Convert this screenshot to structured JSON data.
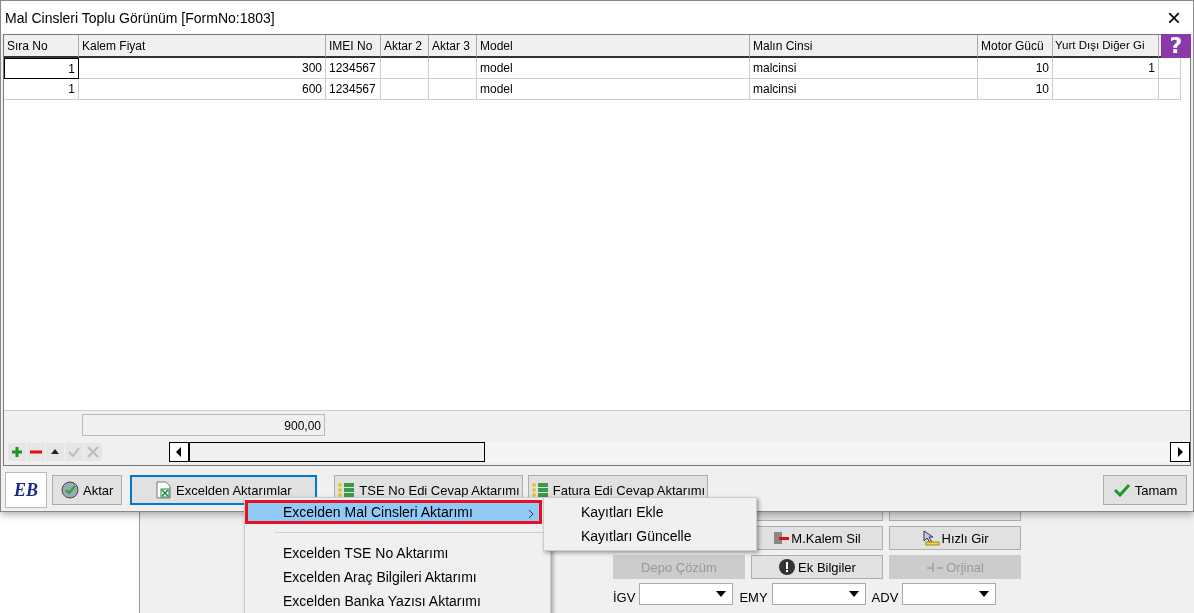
{
  "window": {
    "title": "Mal Cinsleri Toplu Görünüm [FormNo:1803]",
    "close": "×",
    "help": "?"
  },
  "table": {
    "columns": [
      "Sıra No",
      "Kalem Fiyat",
      "IMEI No",
      "Aktar 2",
      "Aktar 3",
      "Model",
      "Malın Cinsi",
      "Motor Gücü",
      "Yurt Dışı Diğer Gi"
    ],
    "rows": [
      {
        "selected": true,
        "cells": [
          "1",
          "300",
          "1234567",
          null,
          null,
          "model",
          "malcinsi",
          "10",
          "1"
        ]
      },
      {
        "selected": false,
        "cells": [
          "1",
          "600",
          "1234567",
          null,
          null,
          "model",
          "malcinsi",
          "10",
          null
        ]
      }
    ],
    "total": "900,00"
  },
  "buttons": [
    {
      "kind": "logo",
      "label": "EB"
    },
    {
      "kind": "aktar",
      "label": "Aktar"
    },
    {
      "kind": "excel",
      "label": "Excelden Aktarımlar",
      "focused": true
    },
    {
      "kind": "list",
      "label": "TSE No Edi Cevap Aktarımı"
    },
    {
      "kind": "list",
      "label": "Fatura Edi Cevap Aktarımı"
    }
  ],
  "ok_button": "Tamam",
  "menu": [
    {
      "label": "Excelden Mal Cinsleri Aktarımı",
      "selected": true,
      "submenu": true
    },
    {
      "label": "Excelden TSE No Aktarımı",
      "selected": false,
      "submenu": false
    },
    {
      "label": "Excelden Araç Bilgileri Aktarımı",
      "selected": false,
      "submenu": false
    },
    {
      "label": "Excelden Banka Yazısı Aktarımı",
      "selected": false,
      "submenu": false
    }
  ],
  "submenu": [
    "Kayıtları Ekle",
    "Kayıtları Güncelle"
  ],
  "background_buttons": [
    {
      "label": "M.Kalem Sil",
      "kind": "delete",
      "disabled": false
    },
    {
      "label": "Hızlı Gir",
      "kind": "quick",
      "disabled": false
    },
    {
      "label": "Depo Çözüm",
      "kind": "plain",
      "disabled": true
    },
    {
      "label": "Ek Bilgiler",
      "kind": "info",
      "disabled": false
    },
    {
      "label": "Orjinal",
      "kind": "original",
      "disabled": true
    }
  ],
  "combos": [
    {
      "label": "İGV"
    },
    {
      "label": "EMY"
    },
    {
      "label": "ADV"
    }
  ]
}
